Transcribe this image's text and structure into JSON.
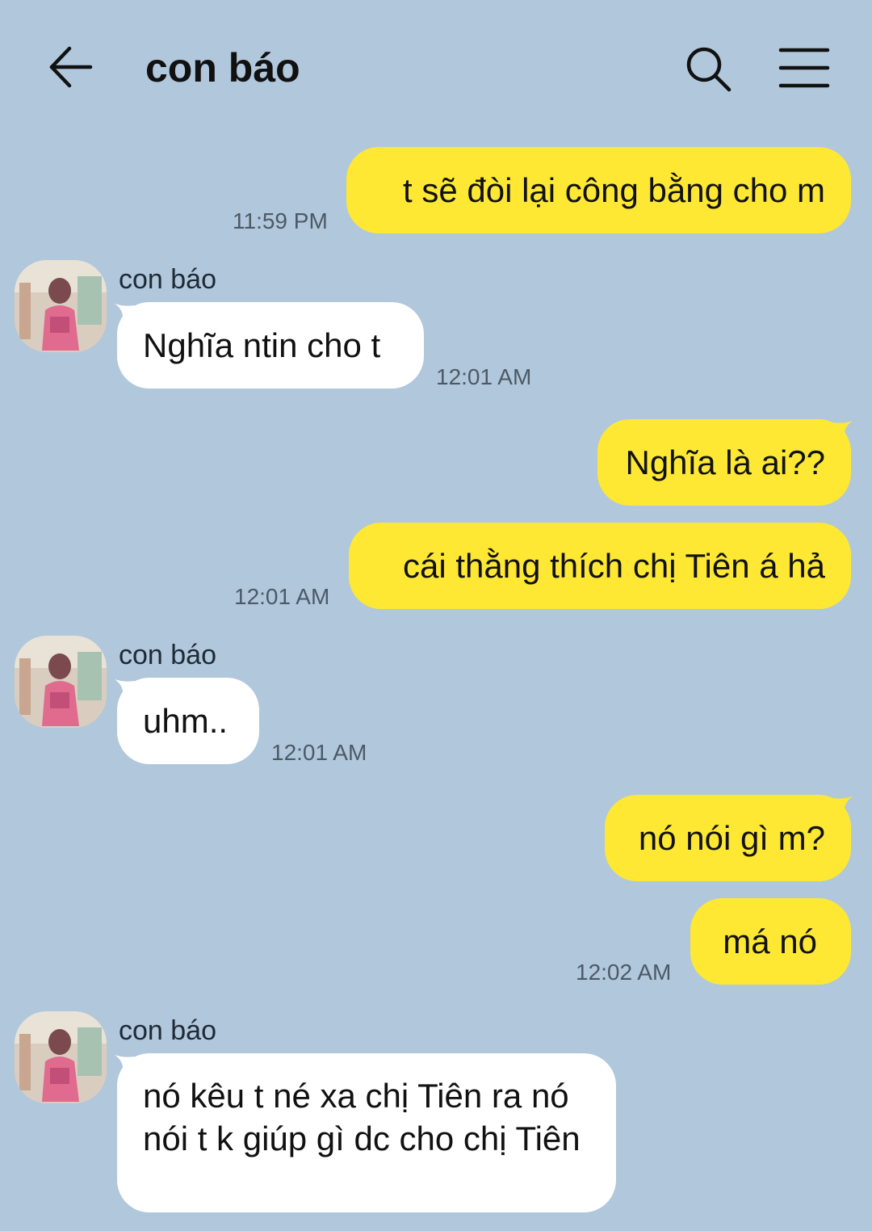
{
  "header": {
    "title": "con báo",
    "back_icon": "arrow-left-icon",
    "search_icon": "search-icon",
    "menu_icon": "hamburger-menu-icon"
  },
  "colors": {
    "background": "#b1c7dc",
    "my_bubble": "#fee833",
    "their_bubble": "#ffffff"
  },
  "messages": [
    {
      "from": "me",
      "text": "t sẽ đòi lại công bằng cho m",
      "time": "11:59 PM"
    },
    {
      "from": "con báo",
      "sender": "con báo",
      "text": "Nghĩa ntin cho t",
      "time": "12:01 AM"
    },
    {
      "from": "me",
      "text": "Nghĩa là ai??"
    },
    {
      "from": "me",
      "text": "cái thằng thích chị Tiên á hả",
      "time": "12:01 AM"
    },
    {
      "from": "con báo",
      "sender": "con báo",
      "text": "uhm..",
      "time": "12:01 AM"
    },
    {
      "from": "me",
      "text": "nó nói gì m?"
    },
    {
      "from": "me",
      "text": "má nó",
      "time": "12:02 AM"
    },
    {
      "from": "con báo",
      "sender": "con báo",
      "text": "nó kêu t né xa chị Tiên ra nó nói t k giúp gì dc cho chị Tiên"
    }
  ]
}
